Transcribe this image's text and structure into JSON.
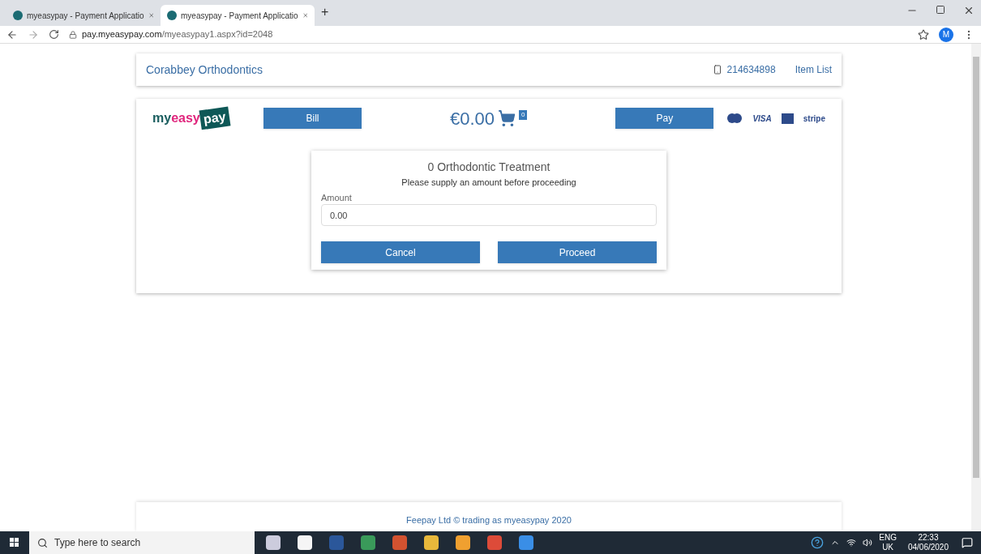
{
  "browser": {
    "tabs": [
      {
        "title": "myeasypay - Payment Applicatio",
        "selected": false
      },
      {
        "title": "myeasypay - Payment Applicatio",
        "selected": true
      }
    ],
    "new_tab": "+",
    "url_host": "pay.myeasypay.com",
    "url_path": "/myeasypay1.aspx?id=2048",
    "profile": "M"
  },
  "header": {
    "practice": "Corabbey Orthodontics",
    "phone": "214634898",
    "item_list": "Item List"
  },
  "logo": [
    "my",
    "easy",
    "pay"
  ],
  "toolbar": {
    "bill": "Bill",
    "total": "€0.00",
    "cart_count": "0",
    "pay": "Pay",
    "card_labels": [
      "VISA",
      "stripe"
    ]
  },
  "dialog": {
    "title": "0 Orthodontic Treatment",
    "message": "Please supply an amount before proceeding",
    "amount_label": "Amount",
    "amount_value": "0.00",
    "cancel": "Cancel",
    "proceed": "Proceed"
  },
  "footer": {
    "text": "Feepay Ltd © trading as myeasypay 2020"
  },
  "taskbar": {
    "search_placeholder": "Type here to search",
    "lang": "ENG",
    "region": "UK",
    "time": "22:33",
    "date": "04/06/2020"
  }
}
